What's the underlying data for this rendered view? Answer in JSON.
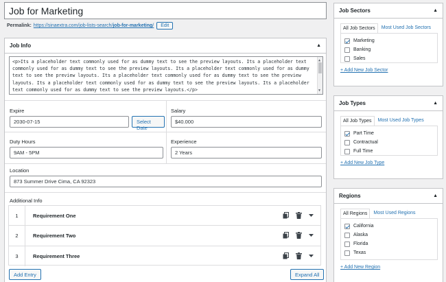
{
  "post": {
    "title": "Job for Marketing",
    "permalink_label": "Permalink:",
    "permalink_base": "https://sinaextra.com/job-lists-search/",
    "permalink_slug": "job-for-marketing",
    "permalink_end": "/",
    "edit_label": "Edit"
  },
  "job_info": {
    "heading": "Job Info",
    "description": "<p>Its a placeholder text commonly used for as dummy text to see the preview layouts. Its a placeholder text commonly used for as dummy text to see the preview layouts. Its a placeholder text commonly used for as dummy text to see the preview layouts. Its a placeholder text commonly used for as dummy text to see the preview layouts. Its a placeholder text commonly used for as dummy text to see the preview layouts. Its a placeholder text commonly used for as dummy text to see the preview layouts.</p>",
    "expire_label": "Expire",
    "expire_value": "2030-07-15",
    "select_date_label": "Select Date",
    "salary_label": "Salary",
    "salary_value": "$40.000",
    "duty_label": "Duty Hours",
    "duty_value": "9AM - 5PM",
    "experience_label": "Experience",
    "experience_value": "2 Years",
    "location_label": "Location",
    "location_value": "873 Summer Drive Cima, CA 92323",
    "additional_label": "Additional Info",
    "requirements": [
      {
        "num": "1",
        "name": "Requirement One"
      },
      {
        "num": "2",
        "name": "Requirement Two"
      },
      {
        "num": "3",
        "name": "Requirement Three"
      }
    ],
    "add_entry_label": "Add Entry",
    "expand_all_label": "Expand All"
  },
  "job_sectors": {
    "heading": "Job Sectors",
    "tab_all": "All Job Sectors",
    "tab_used": "Most Used Job Sectors",
    "items": [
      {
        "label": "Marketing",
        "checked": true
      },
      {
        "label": "Banking",
        "checked": false
      },
      {
        "label": "Sales",
        "checked": false
      }
    ],
    "add_new": "+ Add New Job Sector"
  },
  "job_types": {
    "heading": "Job Types",
    "tab_all": "All Job Types",
    "tab_used": "Most Used Job Types",
    "items": [
      {
        "label": "Part Time",
        "checked": true
      },
      {
        "label": "Contractual",
        "checked": false
      },
      {
        "label": "Full Time",
        "checked": false
      }
    ],
    "add_new": "+ Add New Job Type"
  },
  "regions": {
    "heading": "Regions",
    "tab_all": "All Regions",
    "tab_used": "Most Used Regions",
    "items": [
      {
        "label": "California",
        "checked": true
      },
      {
        "label": "Alaska",
        "checked": false
      },
      {
        "label": "Florida",
        "checked": false
      },
      {
        "label": "Texas",
        "checked": false
      }
    ],
    "add_new": "+ Add New Region"
  },
  "colors": {
    "accent": "#2271b1",
    "border": "#c3c4c7",
    "background": "#f0f0f1"
  },
  "icons": {
    "toggle": "caret-up-icon",
    "copy": "copy-icon",
    "delete": "trash-icon",
    "expand": "caret-down-icon"
  }
}
